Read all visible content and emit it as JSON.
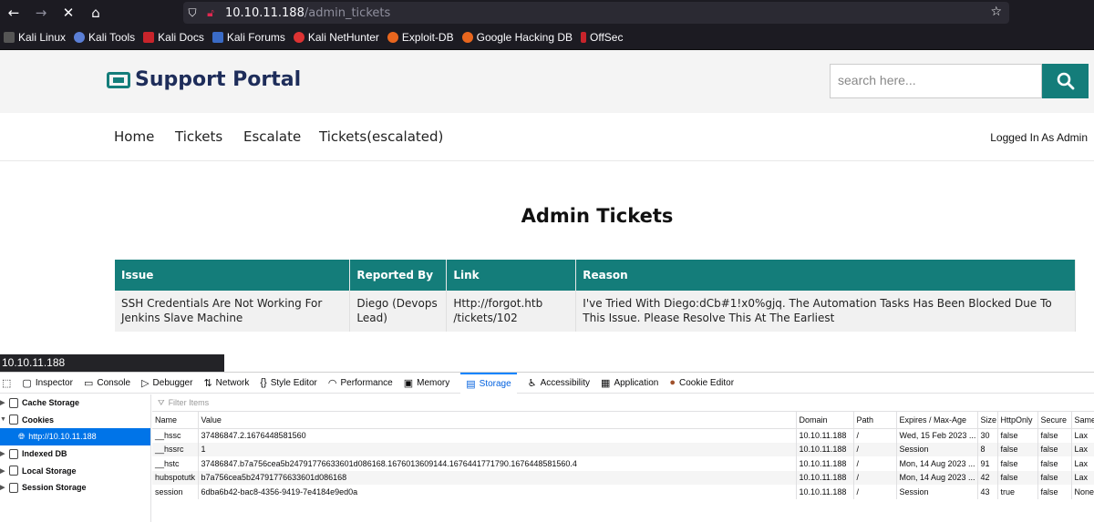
{
  "browser": {
    "url_host": "10.10.11.188",
    "url_path": "/admin_tickets",
    "bookmarks": [
      "Kali Linux",
      "Kali Tools",
      "Kali Docs",
      "Kali Forums",
      "Kali NetHunter",
      "Exploit-DB",
      "Google Hacking DB",
      "OffSec"
    ]
  },
  "site": {
    "logo": "Support Portal",
    "search_placeholder": "search here...",
    "menu": [
      "Home",
      "Tickets",
      "Escalate",
      "Tickets(escalated)"
    ],
    "login_status": "Logged In As Admin",
    "page_title": "Admin Tickets",
    "table_headers": [
      "Issue",
      "Reported By",
      "Link",
      "Reason"
    ],
    "table_rows": [
      {
        "issue": "SSH Credentials Are Not Working For Jenkins Slave Machine",
        "reported_by": "Diego (Devops Lead)",
        "link": "Http://forgot.htb /tickets/102",
        "reason": "I've Tried With Diego:dCb#1!x0%gjq. The Automation Tasks Has Been Blocked Due To This Issue. Please Resolve This At The Earliest"
      }
    ]
  },
  "devtools": {
    "tooltip": "10.10.11.188",
    "tabs": [
      "Inspector",
      "Console",
      "Debugger",
      "Network",
      "Style Editor",
      "Performance",
      "Memory",
      "Storage",
      "Accessibility",
      "Application",
      "Cookie Editor"
    ],
    "active_tab": "Storage",
    "sidebar": [
      "Cache Storage",
      "Cookies",
      "http://10.10.11.188",
      "Indexed DB",
      "Local Storage",
      "Session Storage"
    ],
    "filter_placeholder": "Filter Items",
    "cookie_headers": [
      "Name",
      "Value",
      "Domain",
      "Path",
      "Expires / Max-Age",
      "Size",
      "HttpOnly",
      "Secure",
      "Same"
    ],
    "cookies": [
      [
        "__hssc",
        "37486847.2.1676448581560",
        "10.10.11.188",
        "/",
        "Wed, 15 Feb 2023 ...",
        "30",
        "false",
        "false",
        "Lax"
      ],
      [
        "__hssrc",
        "1",
        "10.10.11.188",
        "/",
        "Session",
        "8",
        "false",
        "false",
        "Lax"
      ],
      [
        "__hstc",
        "37486847.b7a756cea5b24791776633601d086168.1676013609144.1676441771790.1676448581560.4",
        "10.10.11.188",
        "/",
        "Mon, 14 Aug 2023 ...",
        "91",
        "false",
        "false",
        "Lax"
      ],
      [
        "hubspotutk",
        "b7a756cea5b24791776633601d086168",
        "10.10.11.188",
        "/",
        "Mon, 14 Aug 2023 ...",
        "42",
        "false",
        "false",
        "Lax"
      ],
      [
        "session",
        "6dba6b42-bac8-4356-9419-7e4184e9ed0a",
        "10.10.11.188",
        "/",
        "Session",
        "43",
        "true",
        "false",
        "None"
      ]
    ]
  }
}
